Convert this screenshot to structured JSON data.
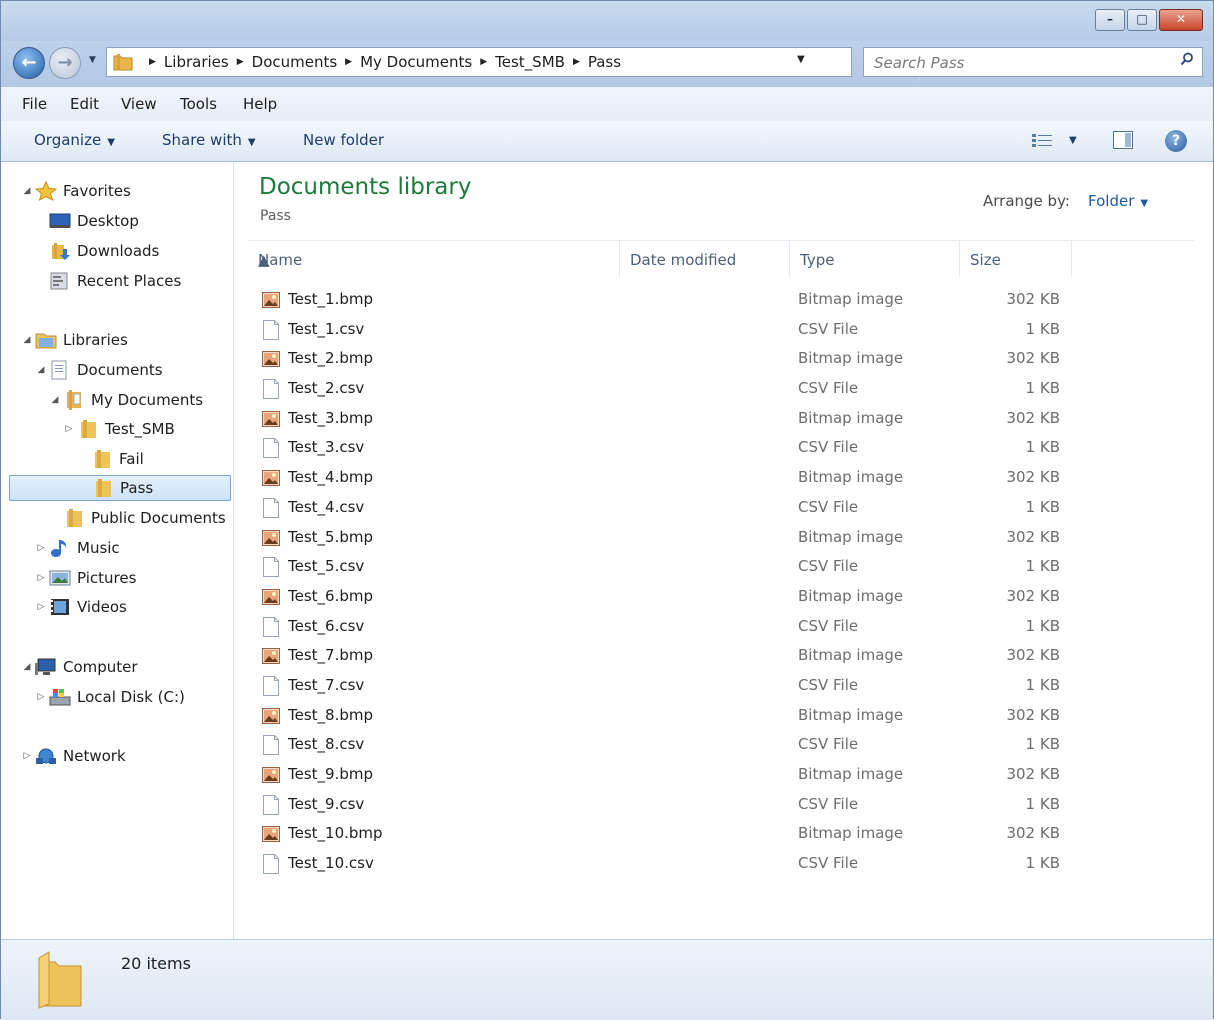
{
  "window": {
    "minimize": "–",
    "maximize": "□",
    "close": "✕"
  },
  "address": {
    "breadcrumbs": [
      "Libraries",
      "Documents",
      "My Documents",
      "Test_SMB",
      "Pass"
    ]
  },
  "search": {
    "placeholder": "Search Pass"
  },
  "menu": [
    "File",
    "Edit",
    "View",
    "Tools",
    "Help"
  ],
  "commands": {
    "organize": "Organize",
    "share_with": "Share with",
    "new_folder": "New folder",
    "help": "?"
  },
  "nav": [
    {
      "label": "Favorites",
      "icon": "star-icon",
      "level": 0,
      "expander": "◢"
    },
    {
      "label": "Desktop",
      "icon": "desktop-icon",
      "level": 1,
      "expander": ""
    },
    {
      "label": "Downloads",
      "icon": "downloads-icon",
      "level": 1,
      "expander": ""
    },
    {
      "label": "Recent Places",
      "icon": "recent-places-icon",
      "level": 1,
      "expander": ""
    },
    {
      "label": "Libraries",
      "icon": "libraries-icon",
      "level": 0,
      "expander": "◢"
    },
    {
      "label": "Documents",
      "icon": "documents-icon",
      "level": 1,
      "expander": "◢"
    },
    {
      "label": "My Documents",
      "icon": "my-documents-icon",
      "level": 2,
      "expander": "◢"
    },
    {
      "label": "Test_SMB",
      "icon": "folder-icon",
      "level": 3,
      "expander": "▷"
    },
    {
      "label": "Fail",
      "icon": "folder-icon",
      "level": 4,
      "expander": ""
    },
    {
      "label": "Pass",
      "icon": "folder-icon",
      "level": 4,
      "expander": "",
      "selected": true
    },
    {
      "label": "Public Documents",
      "icon": "folder-icon",
      "level": 2,
      "expander": ""
    },
    {
      "label": "Music",
      "icon": "music-icon",
      "level": 1,
      "expander": "▷"
    },
    {
      "label": "Pictures",
      "icon": "pictures-icon",
      "level": 1,
      "expander": "▷"
    },
    {
      "label": "Videos",
      "icon": "videos-icon",
      "level": 1,
      "expander": "▷"
    },
    {
      "label": "Computer",
      "icon": "computer-icon",
      "level": 0,
      "expander": "◢"
    },
    {
      "label": "Local Disk (C:)",
      "icon": "local-disk-icon",
      "level": 1,
      "expander": "▷"
    },
    {
      "label": "Network",
      "icon": "network-icon",
      "level": 0,
      "expander": "▷"
    }
  ],
  "library": {
    "title": "Documents library",
    "subtitle": "Pass",
    "arrange_label": "Arrange by:",
    "arrange_value": "Folder"
  },
  "columns": {
    "name": "Name",
    "date_modified": "Date modified",
    "type": "Type",
    "size": "Size"
  },
  "files": [
    {
      "name": "Test_1.bmp",
      "type": "Bitmap image",
      "size": "302 KB",
      "kind": "bmp"
    },
    {
      "name": "Test_1.csv",
      "type": "CSV File",
      "size": "1 KB",
      "kind": "csv"
    },
    {
      "name": "Test_2.bmp",
      "type": "Bitmap image",
      "size": "302 KB",
      "kind": "bmp"
    },
    {
      "name": "Test_2.csv",
      "type": "CSV File",
      "size": "1 KB",
      "kind": "csv"
    },
    {
      "name": "Test_3.bmp",
      "type": "Bitmap image",
      "size": "302 KB",
      "kind": "bmp"
    },
    {
      "name": "Test_3.csv",
      "type": "CSV File",
      "size": "1 KB",
      "kind": "csv"
    },
    {
      "name": "Test_4.bmp",
      "type": "Bitmap image",
      "size": "302 KB",
      "kind": "bmp"
    },
    {
      "name": "Test_4.csv",
      "type": "CSV File",
      "size": "1 KB",
      "kind": "csv"
    },
    {
      "name": "Test_5.bmp",
      "type": "Bitmap image",
      "size": "302 KB",
      "kind": "bmp"
    },
    {
      "name": "Test_5.csv",
      "type": "CSV File",
      "size": "1 KB",
      "kind": "csv"
    },
    {
      "name": "Test_6.bmp",
      "type": "Bitmap image",
      "size": "302 KB",
      "kind": "bmp"
    },
    {
      "name": "Test_6.csv",
      "type": "CSV File",
      "size": "1 KB",
      "kind": "csv"
    },
    {
      "name": "Test_7.bmp",
      "type": "Bitmap image",
      "size": "302 KB",
      "kind": "bmp"
    },
    {
      "name": "Test_7.csv",
      "type": "CSV File",
      "size": "1 KB",
      "kind": "csv"
    },
    {
      "name": "Test_8.bmp",
      "type": "Bitmap image",
      "size": "302 KB",
      "kind": "bmp"
    },
    {
      "name": "Test_8.csv",
      "type": "CSV File",
      "size": "1 KB",
      "kind": "csv"
    },
    {
      "name": "Test_9.bmp",
      "type": "Bitmap image",
      "size": "302 KB",
      "kind": "bmp"
    },
    {
      "name": "Test_9.csv",
      "type": "CSV File",
      "size": "1 KB",
      "kind": "csv"
    },
    {
      "name": "Test_10.bmp",
      "type": "Bitmap image",
      "size": "302 KB",
      "kind": "bmp"
    },
    {
      "name": "Test_10.csv",
      "type": "CSV File",
      "size": "1 KB",
      "kind": "csv"
    }
  ],
  "status": {
    "item_count": "20 items"
  }
}
